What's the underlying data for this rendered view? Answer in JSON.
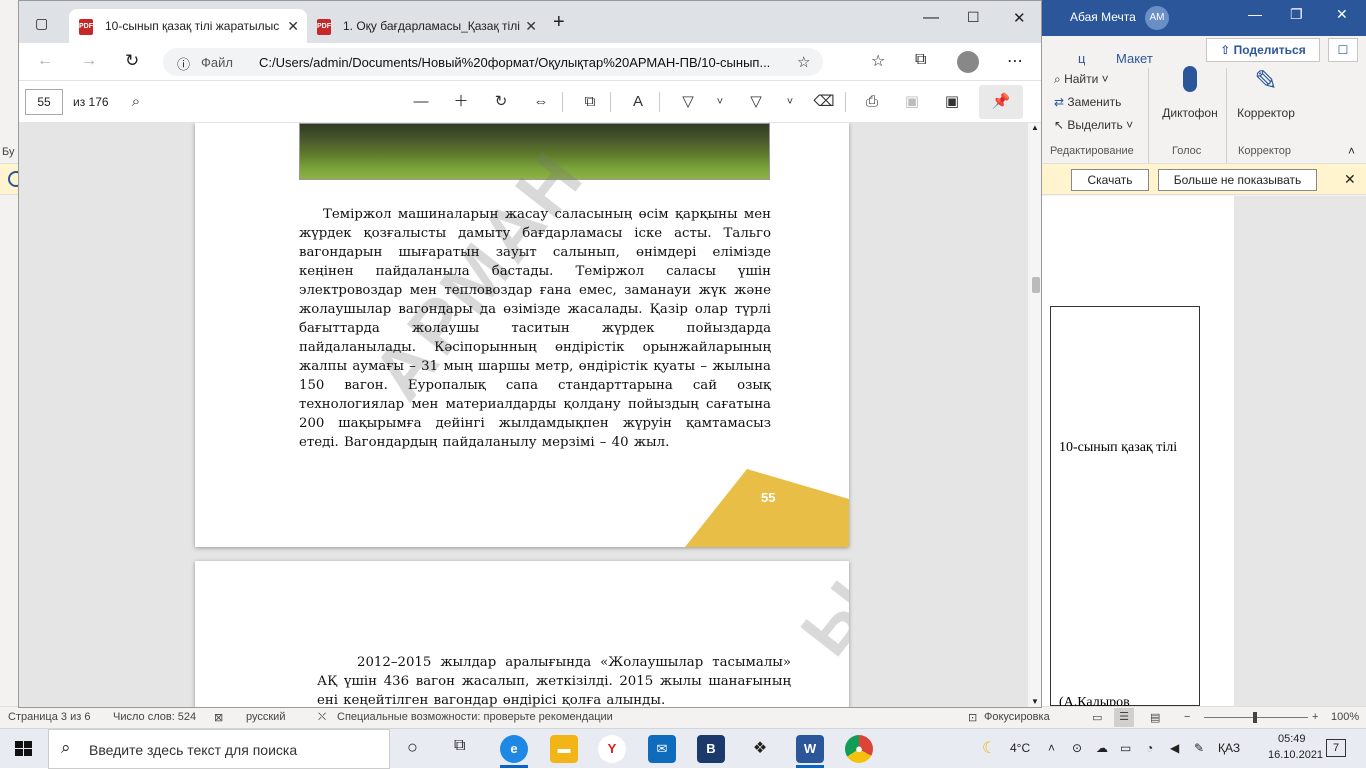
{
  "word": {
    "user": "Абая Мечта",
    "avatar": "АМ",
    "tabs": [
      "ц",
      "Макет"
    ],
    "share": "Поделиться",
    "ribbon_items": {
      "find": "Найти",
      "replace": "Заменить",
      "select": "Выделить",
      "dictate": "Диктофон",
      "editor": "Корректор"
    },
    "group_labels": [
      "Редактирование",
      "Голос",
      "Корректор"
    ],
    "left_cut": "Бу",
    "notification": {
      "download": "Скачать",
      "dismiss": "Больше не показывать"
    },
    "doc_cell_text": "10-сынып қазақ тілі",
    "doc_cell_text2": "(А.Калыров",
    "status": {
      "page": "Страница 3 из 6",
      "words": "Число слов: 524",
      "lang": "русский",
      "access": "Специальные возможности: проверьте рекомендации",
      "focus": "Фокусировка",
      "zoom": "100%",
      "zoom_minus": "−",
      "zoom_plus": "+"
    }
  },
  "browser": {
    "tabs": [
      {
        "label": "10-сынып қазақ тілі жаратылыс",
        "active": true
      },
      {
        "label": "1. Оқу бағдарламасы_Қазақ тілі",
        "active": false
      }
    ],
    "new_tab": "+",
    "address": {
      "scheme": "Файл",
      "url": "C:/Users/admin/Documents/Новый%20формат/Оқулықтар%20АРМАН-ПВ/10-сынып..."
    },
    "pdf_toolbar": {
      "page": "55",
      "of": "из 176"
    }
  },
  "pdf": {
    "para1": "Теміржол машиналарын жасау саласының өсім қарқыны мен жүрдек қозғалысты дамыту бағдарламасы іске асты. Тальго вагондарын шығаратын зауыт салынып, өнімдері елімізде кеңінен пайдаланыла бастады. Теміржол саласы үшін электровоздар мен тепловоздар ғана емес, заманауи жүк және жолаушылар вагондары да өзімізде жасалады. Қазір олар түрлі бағыттарда жолаушы таситын жүрдек пойыздарда пайдаланылады. Кәсіпорынның өндірістік орынжайларының жалпы аумағы – 31 мың шаршы метр, өндірістік қуаты – жылына 150 вагон. Еуропалық сапа стандарттарына сай озық технологиялар мен материалдарды қолдану пойыздың сағатына 200 шақырымға дейінгі жылдамдықпен жүруін қамтамасыз етеді. Вагондардың пайдаланылу мерзімі – 40 жыл.",
    "page_number": "55",
    "watermark": "АРМАН",
    "watermark2": "Ы",
    "para2": "2012–2015 жылдар аралығында «Жолаушылар тасымалы» АҚ үшін 436 вагон жасалып, жеткізілді. 2015 жылы шанағының ені кеңейтілген вагондар өндірісі қолға алынды.",
    "accent_color": "#e9be47"
  },
  "taskbar": {
    "search_placeholder": "Введите здесь текст для поиска",
    "weather": "4°C",
    "lang": "ҚАЗ",
    "time": "05:49",
    "date": "16.10.2021",
    "notif_count": "7"
  }
}
